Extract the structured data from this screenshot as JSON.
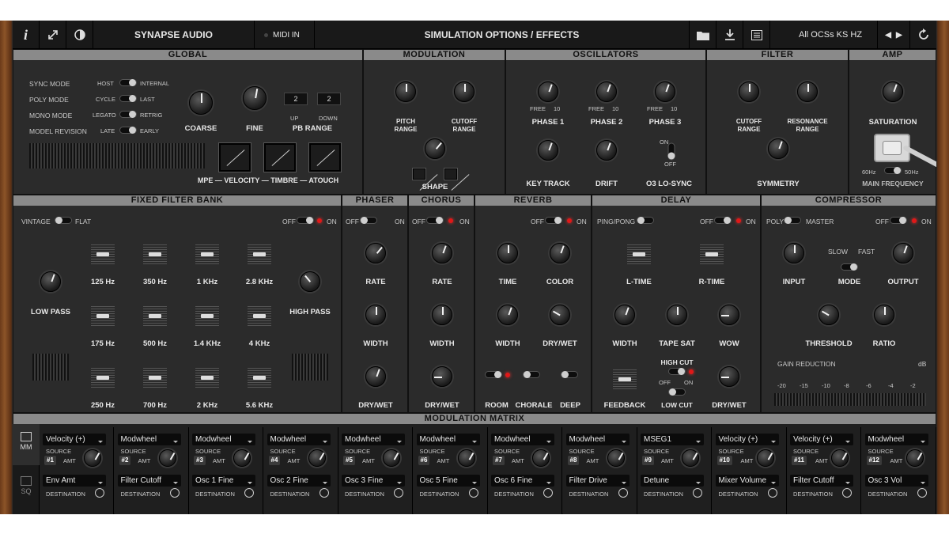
{
  "topbar": {
    "info_icon": "i",
    "brand": "SYNAPSE AUDIO",
    "midi_label": "MIDI IN",
    "title": "SIMULATION OPTIONS / EFFECTS",
    "preset": "All OCSs KS HZ"
  },
  "sections": {
    "global": "GLOBAL",
    "modulation": "MODULATION",
    "oscillators": "OSCILLATORS",
    "filter": "FILTER",
    "amp": "AMP",
    "ffb": "FIXED FILTER BANK",
    "phaser": "PHASER",
    "chorus": "CHORUS",
    "reverb": "REVERB",
    "delay": "DELAY",
    "compressor": "COMPRESSOR",
    "matrix": "MODULATION MATRIX"
  },
  "global": {
    "sync_mode": "SYNC MODE",
    "sync_a": "HOST",
    "sync_b": "INTERNAL",
    "poly_mode": "POLY MODE",
    "poly_a": "CYCLE",
    "poly_b": "LAST",
    "mono_mode": "MONO MODE",
    "mono_a": "LEGATO",
    "mono_b": "RETRIG",
    "model_rev": "MODEL REVISION",
    "model_a": "LATE",
    "model_b": "EARLY",
    "coarse": "COARSE",
    "fine": "FINE",
    "pb_range": "PB RANGE",
    "pb_up": "2",
    "pb_down": "2",
    "up": "UP",
    "down": "DOWN",
    "mpe_line": "MPE — VELOCITY — TIMBRE — ATOUCH"
  },
  "modulation": {
    "pitch_range": "PITCH\nRANGE",
    "cutoff_range": "CUTOFF\nRANGE",
    "shape": "SHAPE"
  },
  "oscillators": {
    "phase1": "PHASE 1",
    "phase2": "PHASE 2",
    "phase3": "PHASE 3",
    "key_track": "KEY TRACK",
    "drift": "DRIFT",
    "lo_sync": "O3 LO-SYNC",
    "on": "ON",
    "off": "OFF",
    "free": "FREE",
    "ten": "10"
  },
  "filter": {
    "cutoff_range": "CUTOFF\nRANGE",
    "resonance_range": "RESONANCE\nRANGE",
    "symmetry": "SYMMETRY"
  },
  "amp": {
    "saturation": "SATURATION",
    "hz60": "60Hz",
    "hz50": "50Hz",
    "main_freq": "MAIN FREQUENCY"
  },
  "ffb": {
    "vintage": "VINTAGE",
    "flat": "FLAT",
    "off": "OFF",
    "on": "ON",
    "low_pass": "LOW PASS",
    "high_pass": "HIGH PASS",
    "bands": [
      "125 Hz",
      "350 Hz",
      "1 KHz",
      "2.8 KHz",
      "175 Hz",
      "500 Hz",
      "1.4 KHz",
      "4 KHz",
      "250 Hz",
      "700 Hz",
      "2 KHz",
      "5.6 KHz"
    ]
  },
  "phaser": {
    "rate": "RATE",
    "width": "WIDTH",
    "drywet": "DRY/WET"
  },
  "chorus": {
    "rate": "RATE",
    "width": "WIDTH",
    "drywet": "DRY/WET"
  },
  "reverb": {
    "time": "TIME",
    "color": "COLOR",
    "width": "WIDTH",
    "drywet": "DRY/WET",
    "room": "ROOM",
    "chorale": "CHORALE",
    "deep": "DEEP"
  },
  "delay": {
    "pingpong": "PING/PONG",
    "ltime": "L-TIME",
    "rtime": "R-TIME",
    "width": "WIDTH",
    "tapesat": "TAPE SAT",
    "wow": "WOW",
    "feedback": "FEEDBACK",
    "highcut": "HIGH CUT",
    "lowcut": "LOW CUT"
  },
  "compressor": {
    "poly": "POLY",
    "master": "MASTER",
    "input": "INPUT",
    "slow": "SLOW",
    "fast": "FAST",
    "mode": "MODE",
    "output": "OUTPUT",
    "threshold": "THRESHOLD",
    "ratio": "RATIO",
    "gain_reduction": "GAIN REDUCTION",
    "db": "dB",
    "scale": [
      "-20",
      "-15",
      "-10",
      "-8",
      "-6",
      "-4",
      "-2"
    ]
  },
  "matrix": {
    "tab_mm": "MM",
    "tab_sq": "SQ",
    "source_lbl": "SOURCE",
    "amt_lbl": "AMT",
    "dest_lbl": "DESTINATION",
    "slots": [
      {
        "src": "Velocity (+)",
        "num": "#1",
        "dest": "Env Amt"
      },
      {
        "src": "Modwheel",
        "num": "#2",
        "dest": "Filter Cutoff"
      },
      {
        "src": "Modwheel",
        "num": "#3",
        "dest": "Osc 1 Fine"
      },
      {
        "src": "Modwheel",
        "num": "#4",
        "dest": "Osc 2 Fine"
      },
      {
        "src": "Modwheel",
        "num": "#5",
        "dest": "Osc 3 Fine"
      },
      {
        "src": "Modwheel",
        "num": "#6",
        "dest": "Osc 5 Fine"
      },
      {
        "src": "Modwheel",
        "num": "#7",
        "dest": "Osc 6 Fine"
      },
      {
        "src": "Modwheel",
        "num": "#8",
        "dest": "Filter Drive"
      },
      {
        "src": "MSEG1",
        "num": "#9",
        "dest": "Detune"
      },
      {
        "src": "Velocity (+)",
        "num": "#10",
        "dest": "Mixer Volume"
      },
      {
        "src": "Velocity (+)",
        "num": "#11",
        "dest": "Filter Cutoff"
      },
      {
        "src": "Modwheel",
        "num": "#12",
        "dest": "Osc 3 Vol"
      }
    ]
  }
}
